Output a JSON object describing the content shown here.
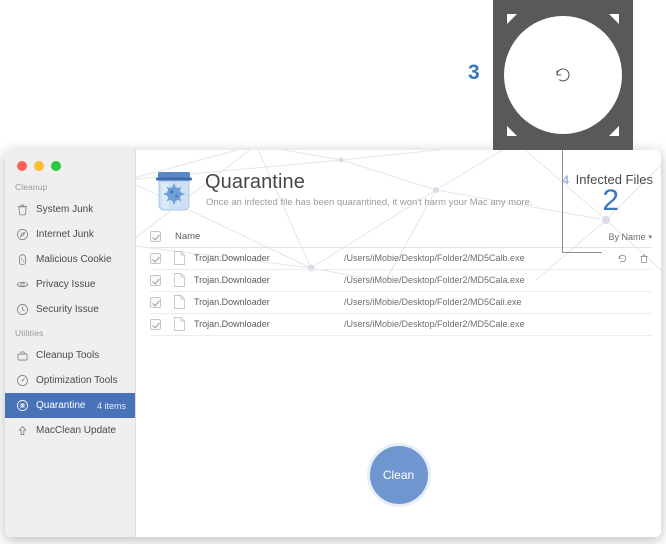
{
  "callouts": {
    "magnifier_number": "3",
    "magnifier_icon": "restore-circular-arrow-icon",
    "infected_number": "4"
  },
  "window": {
    "traffic_lights": [
      "close",
      "minimize",
      "zoom"
    ],
    "sidebar": {
      "sections": [
        {
          "label": "Cleanup",
          "items": [
            {
              "label": "System Junk",
              "icon": "trash-icon",
              "badge": "",
              "selected": false
            },
            {
              "label": "Internet Junk",
              "icon": "compass-icon",
              "badge": "",
              "selected": false
            },
            {
              "label": "Malicious Cookie",
              "icon": "cookie-icon",
              "badge": "",
              "selected": false
            },
            {
              "label": "Privacy Issue",
              "icon": "eye-icon",
              "badge": "",
              "selected": false
            },
            {
              "label": "Security Issue",
              "icon": "shield-icon",
              "badge": "",
              "selected": false
            }
          ]
        },
        {
          "label": "Utilities",
          "items": [
            {
              "label": "Cleanup Tools",
              "icon": "toolbox-icon",
              "badge": "",
              "selected": false
            },
            {
              "label": "Optimization Tools",
              "icon": "gauge-icon",
              "badge": "",
              "selected": false
            },
            {
              "label": "Quarantine",
              "icon": "bug-shield-icon",
              "badge": "4 items",
              "selected": true
            },
            {
              "label": "MacClean Update",
              "icon": "upload-icon",
              "badge": "",
              "selected": false
            }
          ]
        }
      ]
    },
    "header": {
      "icon": "quarantine-jar-icon",
      "title": "Quarantine",
      "subtitle": "Once an infected file has been quarantined, it won't harm your Mac any more.",
      "infected_label": "Infected Files",
      "infected_count": "2"
    },
    "table": {
      "select_all_checked": true,
      "column_name": "Name",
      "sort_label": "By Name",
      "sort_caret": "▾",
      "row_actions": {
        "restore": "restore-icon",
        "delete": "trash-icon"
      },
      "rows": [
        {
          "checked": true,
          "name": "Trojan.Downloader",
          "path": "/Users/iMobie/Desktop/Folder2/MD5Calb.exe"
        },
        {
          "checked": true,
          "name": "Trojan.Downloader",
          "path": "/Users/iMobie/Desktop/Folder2/MD5Cala.exe"
        },
        {
          "checked": true,
          "name": "Trojan.Downloader",
          "path": "/Users/iMobie/Desktop/Folder2/MD5Cali.exe"
        },
        {
          "checked": true,
          "name": "Trojan.Downloader",
          "path": "/Users/iMobie/Desktop/Folder2/MD5Cale.exe"
        }
      ]
    },
    "clean_button_label": "Clean"
  },
  "colors": {
    "accent_blue": "#3b76c4",
    "sidebar_selected": "#4a72b8",
    "clean_button": "#6f96ce",
    "magnifier_bg": "#595959"
  }
}
